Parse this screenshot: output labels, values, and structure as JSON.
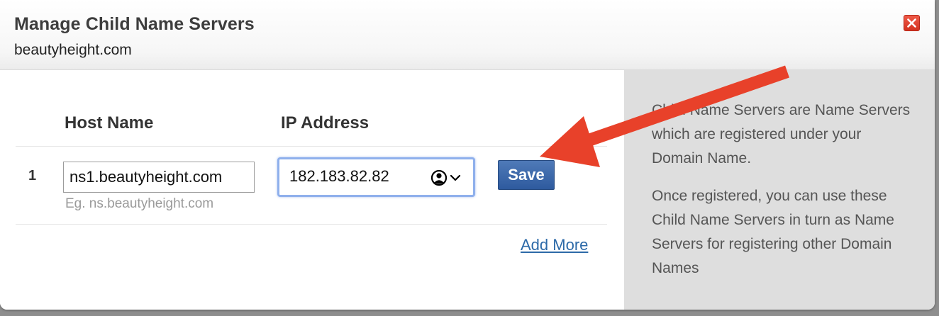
{
  "dialog": {
    "title": "Manage Child Name Servers",
    "domain": "beautyheight.com"
  },
  "table": {
    "headers": {
      "host_name": "Host Name",
      "ip_address": "IP Address"
    },
    "rows": [
      {
        "index": "1",
        "host": "ns1.beautyheight.com",
        "host_hint": "Eg. ns.beautyheight.com",
        "ip": "182.183.82.82"
      }
    ],
    "save_label": "Save",
    "add_more_label": "Add More"
  },
  "sidebar": {
    "paragraphs": [
      "Child Name Servers are Name Servers which are registered under your Domain Name.",
      "Once registered, you can use these Child Name Servers in turn as Name Servers for registering other Domain Names"
    ]
  },
  "icons": {
    "close": "close-icon",
    "autofill": "contact-autofill-icon",
    "annotation": "red-arrow-icon"
  },
  "colors": {
    "close_button": "#d9402c",
    "save_button": "#3a66a8",
    "link": "#2d6aa8",
    "focus_ring": "#8fb0ec",
    "sidebar_bg": "#dedede",
    "annotation_arrow": "#e8412a"
  }
}
